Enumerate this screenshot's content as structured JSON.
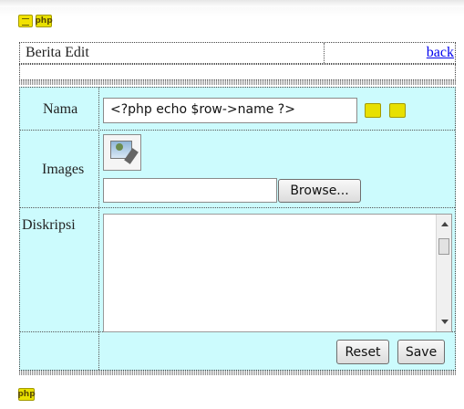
{
  "header": {
    "title": "Berita Edit",
    "back_link": "back"
  },
  "form": {
    "nama_label": "Nama",
    "nama_value": "<?php echo $row->name ?>",
    "images_label": "Images",
    "browse_button": "Browse...",
    "diskripsi_label": "Diskripsi",
    "reset_button": "Reset",
    "save_button": "Save"
  },
  "icons": {
    "php_badge": "php",
    "php_icon_top": "php-icon",
    "doc_icon_top": "doc-icon",
    "php_icon_bottom": "php-icon",
    "field_icon_1": "tag-icon",
    "field_icon_2": "tag-icon",
    "image_placeholder": "image-edit-icon"
  },
  "colors": {
    "table_bg": "#ccfbfd",
    "link": "#0000ee",
    "icon_yellow": "#e8e000"
  }
}
